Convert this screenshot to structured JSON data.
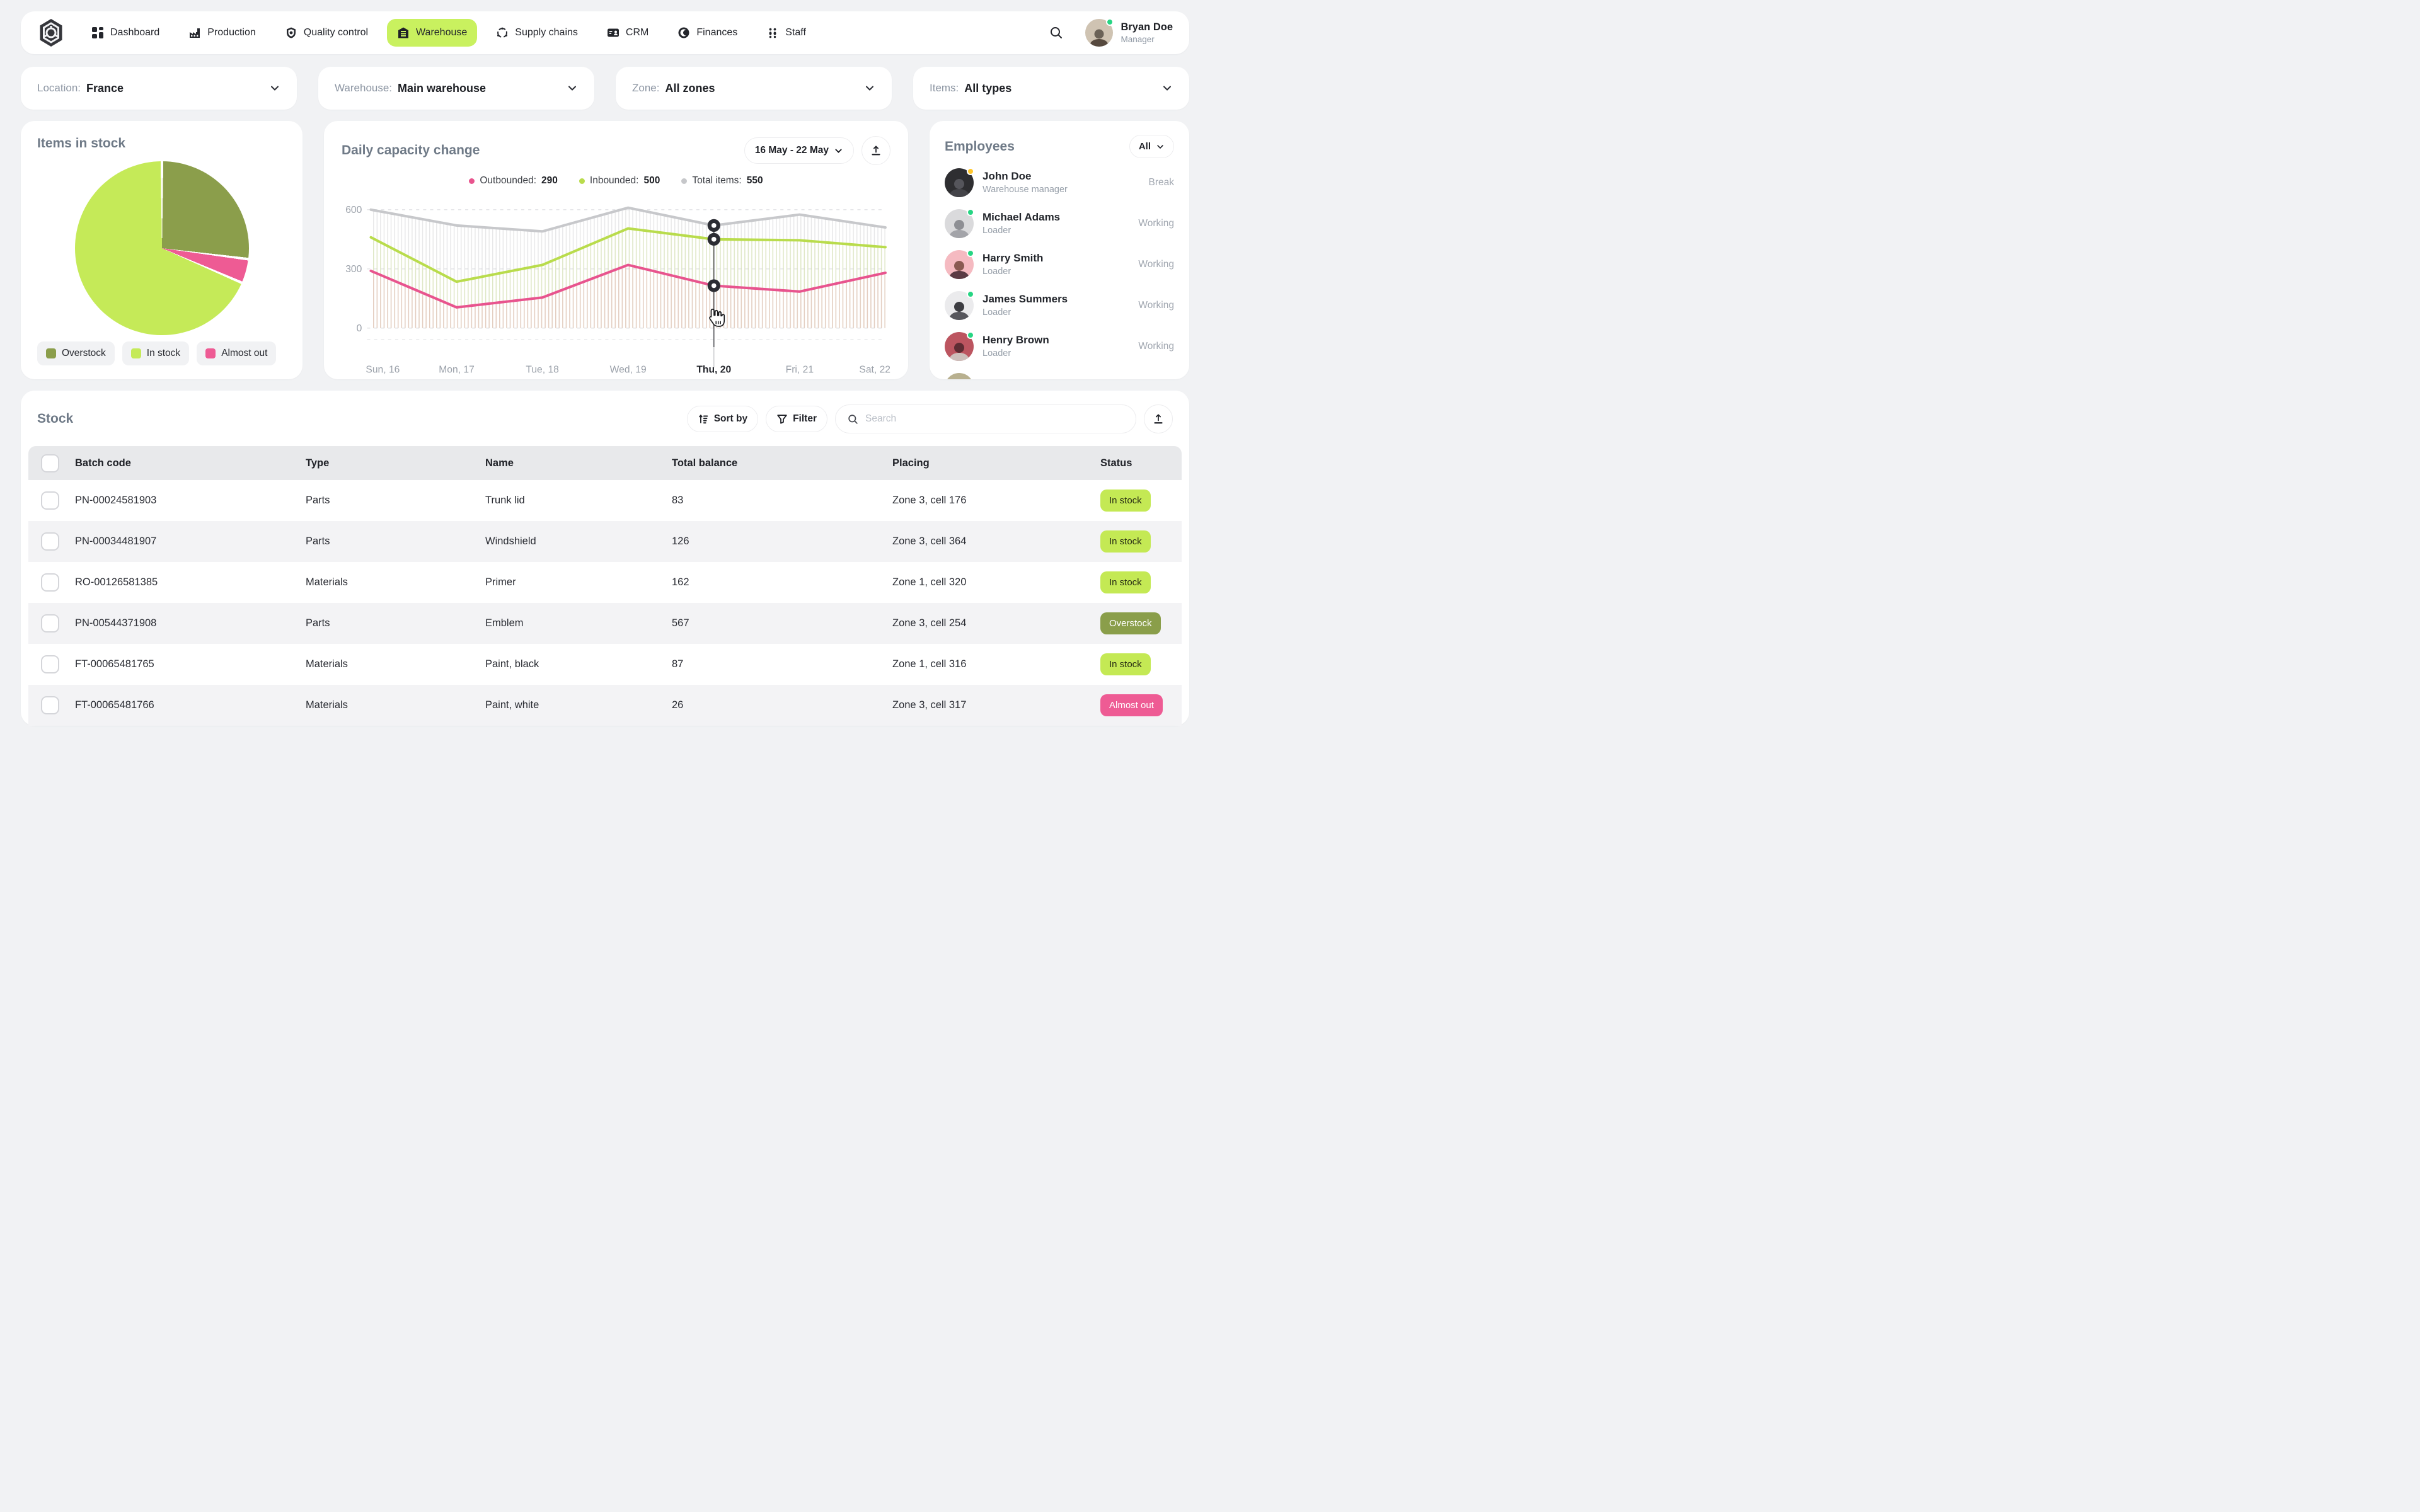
{
  "nav": {
    "items": [
      {
        "label": "Dashboard",
        "icon": "grid-icon"
      },
      {
        "label": "Production",
        "icon": "factory-icon"
      },
      {
        "label": "Quality control",
        "icon": "shield-icon"
      },
      {
        "label": "Warehouse",
        "icon": "warehouse-icon"
      },
      {
        "label": "Supply chains",
        "icon": "supply-chain-icon"
      },
      {
        "label": "CRM",
        "icon": "id-card-icon"
      },
      {
        "label": "Finances",
        "icon": "coin-icon"
      },
      {
        "label": "Staff",
        "icon": "people-icon"
      }
    ],
    "active_item": "Warehouse",
    "user": {
      "name": "Bryan Doe",
      "role": "Manager",
      "status_color": "#26d583"
    }
  },
  "filters": [
    {
      "label": "Location:",
      "value": "France"
    },
    {
      "label": "Warehouse:",
      "value": "Main warehouse"
    },
    {
      "label": "Zone:",
      "value": "All zones"
    },
    {
      "label": "Items:",
      "value": "All types"
    }
  ],
  "items_in_stock": {
    "title": "Items in stock",
    "chart_data": {
      "type": "pie",
      "start_angle_deg": 0,
      "direction": "clockwise",
      "slices": [
        {
          "label": "Overstock",
          "value": 27,
          "color": "#8b9e4b"
        },
        {
          "label": "Almost out",
          "value": 4.5,
          "color": "#ee5b94"
        },
        {
          "label": "In stock",
          "value": 68.5,
          "color": "#c5ea58"
        }
      ]
    },
    "legend": [
      {
        "label": "Overstock",
        "color": "#8b9e4b"
      },
      {
        "label": "In stock",
        "color": "#c5ea58"
      },
      {
        "label": "Almost out",
        "color": "#ee5b94"
      }
    ]
  },
  "daily_capacity": {
    "title": "Daily capacity change",
    "date_range": "16 May - 22 May",
    "legend": [
      {
        "label": "Outbounded:",
        "value": "290",
        "color": "#e8548e"
      },
      {
        "label": "Inbounded:",
        "value": "500",
        "color": "#b9dc4c"
      },
      {
        "label": "Total items:",
        "value": "550",
        "color": "#c6c7ca"
      }
    ],
    "chart_data": {
      "type": "line",
      "x": [
        "Sun, 16",
        "Mon, 17",
        "Tue, 18",
        "Wed, 19",
        "Thu, 20",
        "Fri, 21",
        "Sat, 22"
      ],
      "selected_x": "Thu, 20",
      "yticks": [
        0,
        300,
        600
      ],
      "ylim": [
        0,
        650
      ],
      "grid": "dashed-horizontal",
      "legend_position": "top-center",
      "series": [
        {
          "name": "Total items",
          "color": "#c7c8cb",
          "stripe": "#aaabae",
          "values": [
            600,
            520,
            490,
            610,
            520,
            575,
            510
          ]
        },
        {
          "name": "Inbounded",
          "color": "#b9dc4c",
          "stripe": "#c8e36a",
          "values": [
            460,
            235,
            320,
            505,
            450,
            445,
            410
          ]
        },
        {
          "name": "Outbounded",
          "color": "#e8548e",
          "stripe": "#ef8ab4",
          "values": [
            290,
            105,
            155,
            320,
            215,
            185,
            280
          ]
        }
      ]
    }
  },
  "employees": {
    "title": "Employees",
    "filter_label": "All",
    "status_colors": {
      "Working": "#26d583",
      "Break": "#ffc62b"
    },
    "list": [
      {
        "name": "John Doe",
        "role": "Warehouse manager",
        "status": "Break",
        "dot": "#ffc62b"
      },
      {
        "name": "Michael Adams",
        "role": "Loader",
        "status": "Working",
        "dot": "#26d583"
      },
      {
        "name": "Harry Smith",
        "role": "Loader",
        "status": "Working",
        "dot": "#26d583"
      },
      {
        "name": "James Summers",
        "role": "Loader",
        "status": "Working",
        "dot": "#26d583"
      },
      {
        "name": "Henry Brown",
        "role": "Loader",
        "status": "Working",
        "dot": "#26d583"
      }
    ]
  },
  "stock": {
    "title": "Stock",
    "toolbar": {
      "sort_label": "Sort by",
      "filter_label": "Filter",
      "search_placeholder": "Search"
    },
    "columns": [
      "Batch code",
      "Type",
      "Name",
      "Total balance",
      "Placing",
      "Status"
    ],
    "rows": [
      {
        "batch": "PN-00024581903",
        "type": "Parts",
        "name": "Trunk lid",
        "balance": "83",
        "placing": "Zone 3, cell 176",
        "status": "In stock"
      },
      {
        "batch": "PN-00034481907",
        "type": "Parts",
        "name": "Windshield",
        "balance": "126",
        "placing": "Zone 3, cell 364",
        "status": "In stock"
      },
      {
        "batch": "RO-00126581385",
        "type": "Materials",
        "name": "Primer",
        "balance": "162",
        "placing": "Zone 1, cell 320",
        "status": "In stock"
      },
      {
        "batch": "PN-00544371908",
        "type": "Parts",
        "name": "Emblem",
        "balance": "567",
        "placing": "Zone 3, cell 254",
        "status": "Overstock"
      },
      {
        "batch": "FT-00065481765",
        "type": "Materials",
        "name": "Paint, black",
        "balance": "87",
        "placing": "Zone 1, cell 316",
        "status": "In stock"
      },
      {
        "batch": "FT-00065481766",
        "type": "Materials",
        "name": "Paint, white",
        "balance": "26",
        "placing": "Zone 3, cell 317",
        "status": "Almost out"
      }
    ]
  }
}
